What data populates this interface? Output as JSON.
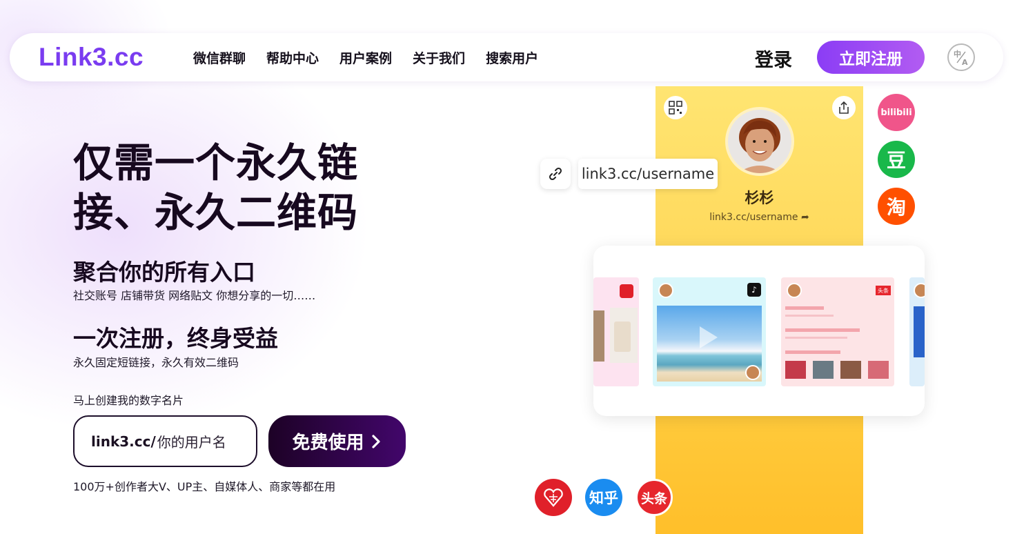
{
  "nav": {
    "logo": "Link3.cc",
    "links": [
      "微信群聊",
      "帮助中心",
      "用户案例",
      "关于我们",
      "搜索用户"
    ],
    "login": "登录",
    "signup": "立即注册"
  },
  "hero": {
    "headline_line1": "仅需一个永久链",
    "headline_line2": "接、永久二维码",
    "section1_title": "聚合你的所有入口",
    "section1_sub": "社交账号 店铺带货 网络贴文 你想分享的一切……",
    "section2_title": "一次注册，终身受益",
    "section2_sub": "永久固定短链接，永久有效二维码",
    "create_label": "马上创建我的数字名片",
    "input_prefix": "link3.cc/",
    "input_placeholder": "你的用户名",
    "cta_label": "免费使用",
    "social_proof": "100万+创作者大V、UP主、自媒体人、商家等都在用"
  },
  "illustration": {
    "profile_name": "杉杉",
    "profile_url": "link3.cc/username",
    "link_chip_url": "link3.cc/username",
    "sns_badges": {
      "bilibili": "bilibili",
      "douban": "豆",
      "taobao": "淘",
      "zhihu": "知乎",
      "toutiao": "头条",
      "toutiao_card_tag": "头条"
    },
    "colors": {
      "brand": "#7a3cf0",
      "bilibili": "#f0558a",
      "douban": "#19b84a",
      "taobao": "#ff5000",
      "zhihu": "#1a8cf0",
      "toutiao": "#e6262d",
      "pinduoduo": "#e0202a"
    }
  }
}
